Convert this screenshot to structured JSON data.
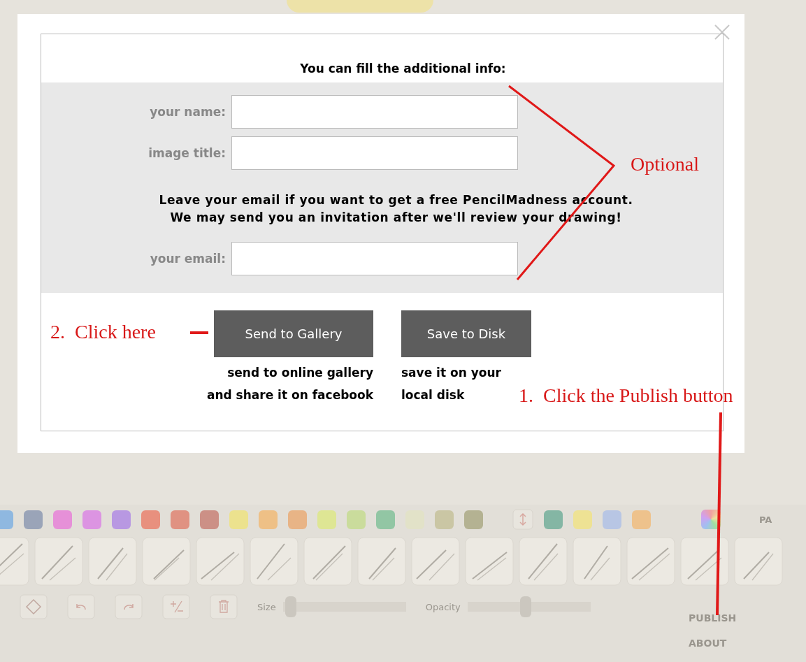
{
  "toolbar": {
    "swatches": [
      {
        "color": "#8fb8e0"
      },
      {
        "color": "#9aa4b8"
      },
      {
        "color": "#e690d8"
      },
      {
        "color": "#dc94e2"
      },
      {
        "color": "#b898e2"
      },
      {
        "color": "#e8907e"
      },
      {
        "color": "#e09282"
      },
      {
        "color": "#cc9086"
      },
      {
        "color": "#ece28e"
      },
      {
        "color": "#eec086"
      },
      {
        "color": "#e8b486"
      },
      {
        "color": "#dee694"
      },
      {
        "color": "#cadc9c"
      },
      {
        "color": "#92c6a4"
      },
      {
        "color": "#e2e2c8"
      },
      {
        "color": "#cac6a4"
      },
      {
        "color": "#b4b292"
      }
    ],
    "extra_swatches": [
      {
        "color": "#84b6a4"
      },
      {
        "color": "#eee294"
      },
      {
        "color": "#b8c6e4"
      },
      {
        "color": "#eec28c"
      }
    ],
    "palette_label": "PA",
    "sliders": [
      {
        "label": "Size",
        "level": 0.02
      },
      {
        "label": "Opacity",
        "level": 0.47
      }
    ],
    "menu": [
      "PUBLISH",
      "ABOUT"
    ]
  },
  "dialog": {
    "title": "You can fill the additional info:",
    "fields": [
      {
        "label": "your name:"
      },
      {
        "label": "image title:"
      }
    ],
    "notice": [
      "Leave your email if you want to get a free PencilMadness account.",
      "We may send you an invitation after we'll review your drawing!"
    ],
    "email_field": {
      "label": "your email:"
    },
    "buttons": [
      {
        "label": "Send to Gallery",
        "caption": [
          "send to online gallery",
          "and share it on facebook"
        ]
      },
      {
        "label": "Save to Disk",
        "caption": [
          "save it on your",
          "local disk"
        ]
      }
    ]
  },
  "annotations": {
    "optional": "Optional",
    "click_here": "2.  Click here",
    "publish_hint": "1.  Click the Publish button"
  }
}
